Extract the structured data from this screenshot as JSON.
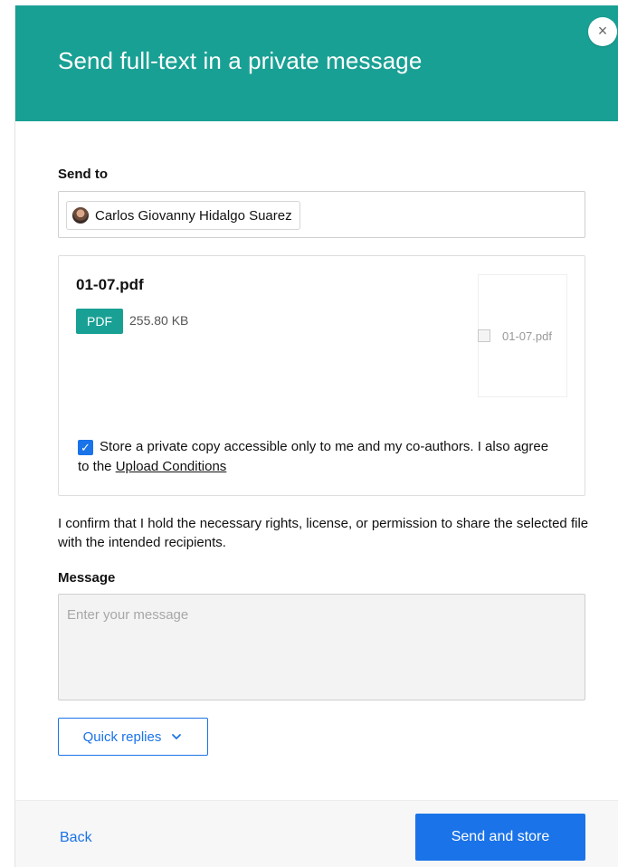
{
  "dialog": {
    "title": "Send full-text in a private message",
    "close_icon": "close-icon",
    "close_glyph": "×"
  },
  "send_to": {
    "label": "Send to",
    "recipient": {
      "name": "Carlos Giovanny Hidalgo Suarez",
      "avatar": "avatar-icon"
    }
  },
  "file": {
    "name": "01-07.pdf",
    "type_badge": "PDF",
    "size": "255.80 KB",
    "thumbnail_alt": "01-07.pdf",
    "store_checked": true,
    "store_text": "Store a private copy accessible only to me and my co-authors. I also agree to the ",
    "upload_conditions_link": "Upload Conditions"
  },
  "confirm_text": "I confirm that I hold the necessary rights, license, or permission to share the selected file with the intended recipients.",
  "message": {
    "label": "Message",
    "placeholder": "Enter your message",
    "value": ""
  },
  "quick_replies": {
    "label": "Quick replies",
    "icon": "chevron-down-icon"
  },
  "footer": {
    "back_label": "Back",
    "submit_label": "Send and store"
  },
  "colors": {
    "header": "#19a094",
    "accent": "#1a73e8",
    "pdf_badge": "#19a094"
  }
}
